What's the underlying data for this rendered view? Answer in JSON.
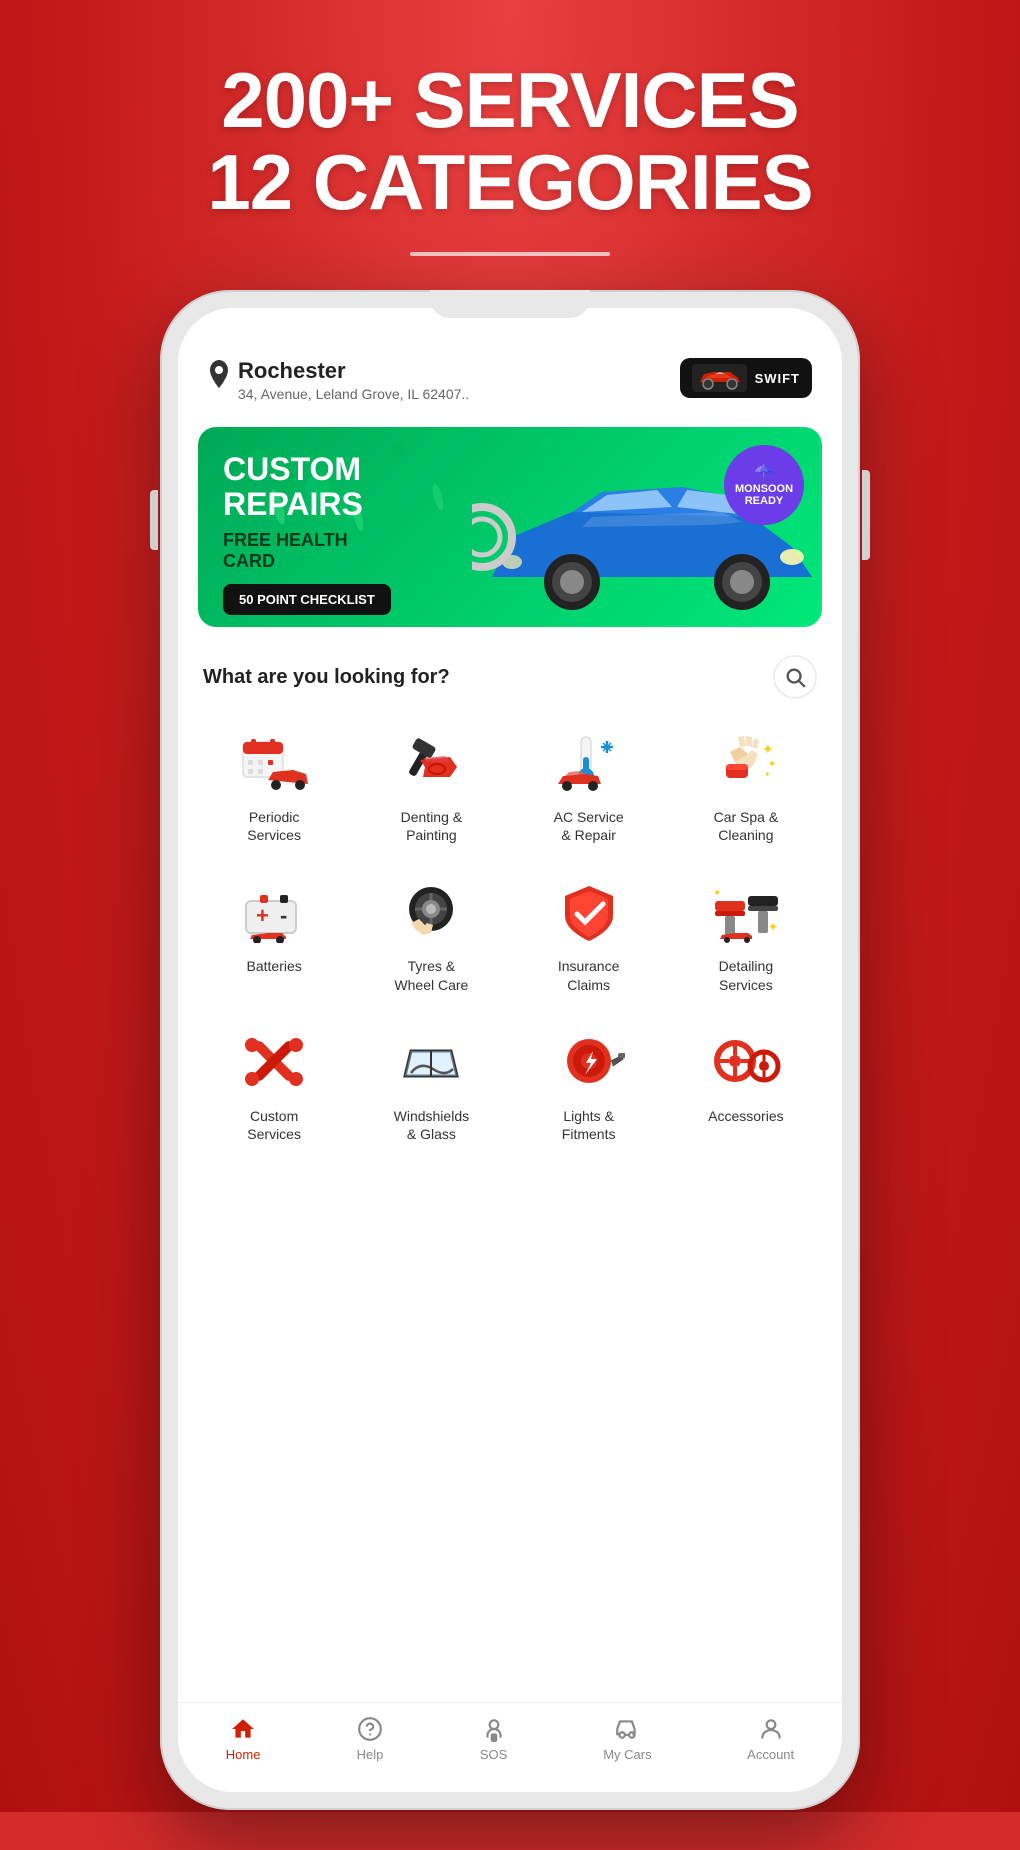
{
  "hero": {
    "line1": "200+ SERVICES",
    "line2": "12 CATEGORIES"
  },
  "header": {
    "city": "Rochester",
    "address": "34, Avenue, Leland Grove, IL 62407..",
    "car_name": "SWIFT"
  },
  "banner": {
    "title": "CUSTOM\nREPAIRS",
    "subtitle": "FREE HEALTH\nCARD",
    "cta": "50 POINT CHECKLIST",
    "badge_line1": "MONSOON",
    "badge_line2": "READY"
  },
  "search": {
    "label": "What are you looking for?"
  },
  "services": [
    {
      "id": "periodic",
      "label": "Periodic\nServices",
      "icon": "calendar-car"
    },
    {
      "id": "denting",
      "label": "Denting &\nPainting",
      "icon": "paint-gun"
    },
    {
      "id": "ac",
      "label": "AC Service\n& Repair",
      "icon": "ac-car"
    },
    {
      "id": "spa",
      "label": "Car Spa &\nCleaning",
      "icon": "cleaning"
    },
    {
      "id": "batteries",
      "label": "Batteries",
      "icon": "battery"
    },
    {
      "id": "tyres",
      "label": "Tyres &\nWheel Care",
      "icon": "tyre"
    },
    {
      "id": "insurance",
      "label": "Insurance\nClaims",
      "icon": "shield"
    },
    {
      "id": "detailing",
      "label": "Detailing\nServices",
      "icon": "detail"
    },
    {
      "id": "custom",
      "label": "Custom\nServices",
      "icon": "wrench"
    },
    {
      "id": "windshield",
      "label": "Windshields\n& Glass",
      "icon": "windshield"
    },
    {
      "id": "lights",
      "label": "Lights &\nFitments",
      "icon": "light"
    },
    {
      "id": "accessories",
      "label": "Accessories",
      "icon": "accessories"
    }
  ],
  "nav": {
    "items": [
      {
        "id": "home",
        "label": "Home",
        "active": true
      },
      {
        "id": "help",
        "label": "Help",
        "active": false
      },
      {
        "id": "sos",
        "label": "SOS",
        "active": false
      },
      {
        "id": "mycars",
        "label": "My Cars",
        "active": false
      },
      {
        "id": "account",
        "label": "Account",
        "active": false
      }
    ]
  }
}
